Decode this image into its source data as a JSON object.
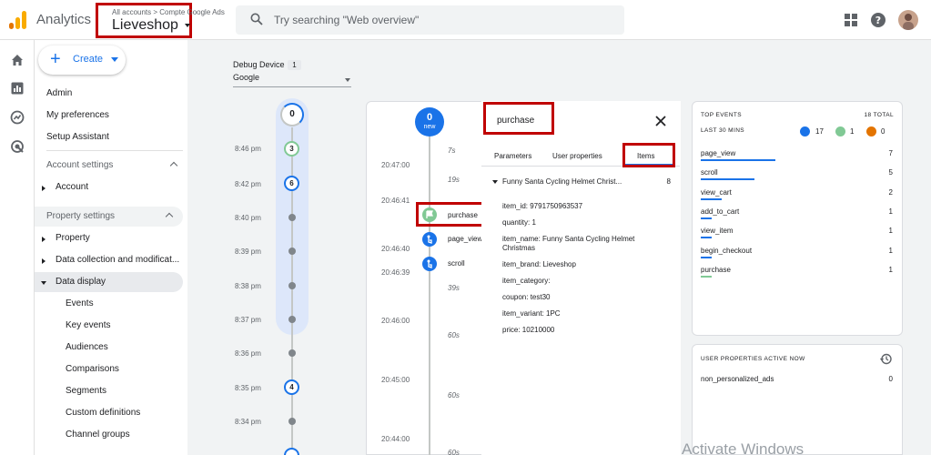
{
  "header": {
    "app_title": "Analytics",
    "breadcrumb": "All accounts > Compte Google Ads",
    "property_name": "Lieveshop",
    "search_placeholder": "Try searching \"Web overview\""
  },
  "sidebar": {
    "create_label": "Create",
    "items": [
      {
        "label": "Admin"
      },
      {
        "label": "My preferences"
      },
      {
        "label": "Setup Assistant"
      },
      {
        "label": "Account settings"
      },
      {
        "label": "Account"
      },
      {
        "label": "Property settings"
      },
      {
        "label": "Property"
      },
      {
        "label": "Data collection and modificat..."
      },
      {
        "label": "Data display"
      },
      {
        "label": "Events"
      },
      {
        "label": "Key events"
      },
      {
        "label": "Audiences"
      },
      {
        "label": "Comparisons"
      },
      {
        "label": "Segments"
      },
      {
        "label": "Custom definitions"
      },
      {
        "label": "Channel groups"
      }
    ]
  },
  "debug_device": {
    "label": "Debug Device",
    "count": "1",
    "selected": "Google"
  },
  "minutes_stream": {
    "top_count": "0",
    "rows": [
      {
        "time": "8:46 pm",
        "badge": "3"
      },
      {
        "time": "8:42 pm",
        "badge": "6"
      },
      {
        "time": "8:40 pm",
        "badge": ""
      },
      {
        "time": "8:39 pm",
        "badge": ""
      },
      {
        "time": "8:38 pm",
        "badge": ""
      },
      {
        "time": "8:37 pm",
        "badge": ""
      },
      {
        "time": "8:36 pm",
        "badge": ""
      },
      {
        "time": "8:35 pm",
        "badge": "4"
      },
      {
        "time": "8:34 pm",
        "badge": ""
      }
    ]
  },
  "seconds_stream": {
    "top_count": "0",
    "top_label": "new",
    "timestamps": [
      "20:47:00",
      "20:46:41",
      "20:46:40",
      "20:46:39",
      "20:46:00",
      "20:45:00",
      "20:44:00"
    ],
    "gaps": [
      "7s",
      "19s",
      "39s",
      "60s",
      "60s",
      "60s"
    ],
    "events": [
      {
        "name": "purchase"
      },
      {
        "name": "page_view"
      },
      {
        "name": "scroll"
      }
    ]
  },
  "event_details": {
    "title": "purchase",
    "tabs": [
      "Parameters",
      "User properties",
      "Items"
    ],
    "item_name": "Funny Santa Cycling Helmet Christ...",
    "item_count": "8",
    "params": [
      "item_id: 9791750963537",
      "quantity: 1",
      "item_name: Funny Santa Cycling Helmet Christmas",
      "item_brand: Lieveshop",
      "item_category:",
      "coupon: test30",
      "item_variant: 1PC",
      "price: 10210000"
    ]
  },
  "top_events": {
    "title": "TOP EVENTS",
    "total": "18 TOTAL",
    "last_label": "LAST 30 MINS",
    "counts": {
      "blue": "17",
      "green": "1",
      "orange": "0"
    },
    "rows": [
      {
        "name": "page_view",
        "count": "7"
      },
      {
        "name": "scroll",
        "count": "5"
      },
      {
        "name": "view_cart",
        "count": "2"
      },
      {
        "name": "add_to_cart",
        "count": "1"
      },
      {
        "name": "view_item",
        "count": "1"
      },
      {
        "name": "begin_checkout",
        "count": "1"
      },
      {
        "name": "purchase",
        "count": "1"
      }
    ]
  },
  "user_properties": {
    "title": "USER PROPERTIES ACTIVE NOW",
    "rows": [
      {
        "name": "non_personalized_ads",
        "count": "0"
      }
    ]
  },
  "watermark": "Activate Windows",
  "colors": {
    "accent": "#1a73e8",
    "key_event_green": "#81c995",
    "highlight_red": "#c00000",
    "conversion_orange": "#e37400"
  }
}
